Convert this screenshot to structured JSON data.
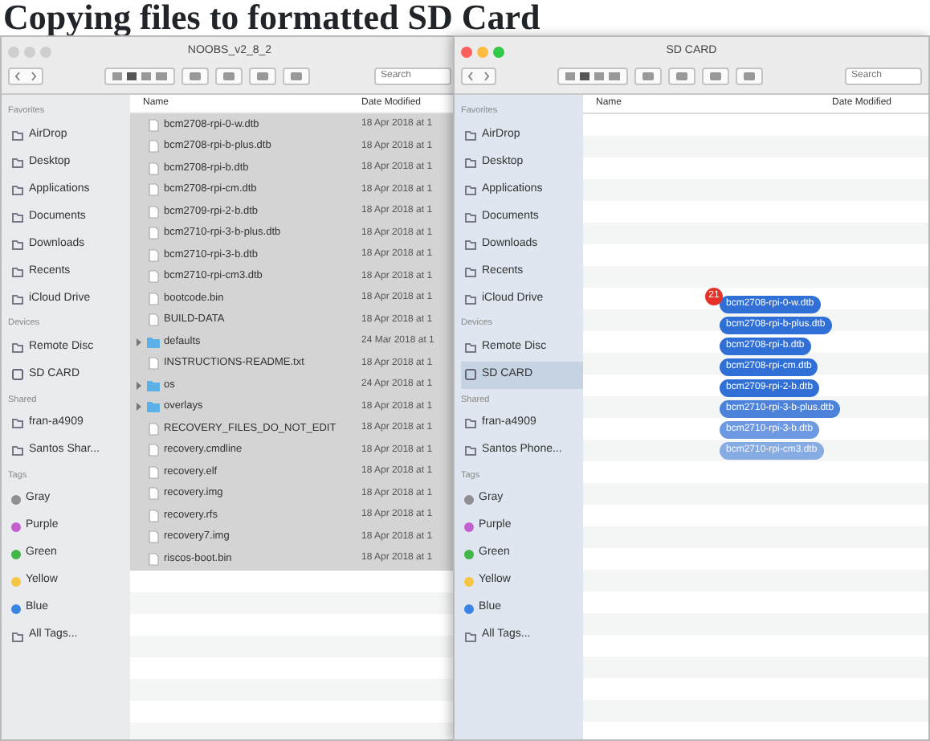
{
  "heading": "Copying files to formatted SD Card",
  "windows": [
    {
      "title": "NOOBS_v2_8_2",
      "active": false,
      "search": {
        "placeholder": "Search"
      },
      "sidebar": [
        {
          "section": "Favorites",
          "items": [
            {
              "label": "AirDrop",
              "kind": "place",
              "selected": false
            },
            {
              "label": "Desktop",
              "kind": "place",
              "selected": false
            },
            {
              "label": "Applications",
              "kind": "place",
              "selected": false
            },
            {
              "label": "Documents",
              "kind": "place",
              "selected": false
            },
            {
              "label": "Downloads",
              "kind": "place",
              "selected": false
            },
            {
              "label": "Recents",
              "kind": "place",
              "selected": false
            },
            {
              "label": "iCloud Drive",
              "kind": "place",
              "selected": false
            }
          ]
        },
        {
          "section": "Devices",
          "items": [
            {
              "label": "Remote Disc",
              "kind": "place",
              "selected": false
            },
            {
              "label": "SD CARD",
              "kind": "device",
              "selected": false
            }
          ]
        },
        {
          "section": "Shared",
          "items": [
            {
              "label": "fran-a4909",
              "kind": "place",
              "selected": false
            },
            {
              "label": "Santos Shar...",
              "kind": "place",
              "selected": false
            }
          ]
        },
        {
          "section": "Tags",
          "items": [
            {
              "label": "Gray",
              "kind": "tag",
              "color": "#8e8e93",
              "selected": false
            },
            {
              "label": "Purple",
              "kind": "tag",
              "color": "#c45fd0",
              "selected": false
            },
            {
              "label": "Green",
              "kind": "tag",
              "color": "#43b649",
              "selected": false
            },
            {
              "label": "Yellow",
              "kind": "tag",
              "color": "#f5c544",
              "selected": false
            },
            {
              "label": "Blue",
              "kind": "tag",
              "color": "#3a84e6",
              "selected": false
            },
            {
              "label": "All Tags...",
              "kind": "place",
              "selected": false
            }
          ]
        }
      ],
      "columns": [
        "Name",
        "Date Modified"
      ],
      "rows": [
        {
          "name": "bcm2708-rpi-0-w.dtb",
          "kind": "file",
          "date": "18 Apr 2018 at 1",
          "selected": true
        },
        {
          "name": "bcm2708-rpi-b-plus.dtb",
          "kind": "file",
          "date": "18 Apr 2018 at 1",
          "selected": true
        },
        {
          "name": "bcm2708-rpi-b.dtb",
          "kind": "file",
          "date": "18 Apr 2018 at 1",
          "selected": true
        },
        {
          "name": "bcm2708-rpi-cm.dtb",
          "kind": "file",
          "date": "18 Apr 2018 at 1",
          "selected": true
        },
        {
          "name": "bcm2709-rpi-2-b.dtb",
          "kind": "file",
          "date": "18 Apr 2018 at 1",
          "selected": true
        },
        {
          "name": "bcm2710-rpi-3-b-plus.dtb",
          "kind": "file",
          "date": "18 Apr 2018 at 1",
          "selected": true
        },
        {
          "name": "bcm2710-rpi-3-b.dtb",
          "kind": "file",
          "date": "18 Apr 2018 at 1",
          "selected": true
        },
        {
          "name": "bcm2710-rpi-cm3.dtb",
          "kind": "file",
          "date": "18 Apr 2018 at 1",
          "selected": true
        },
        {
          "name": "bootcode.bin",
          "kind": "file",
          "date": "18 Apr 2018 at 1",
          "selected": true
        },
        {
          "name": "BUILD-DATA",
          "kind": "file",
          "date": "18 Apr 2018 at 1",
          "selected": true
        },
        {
          "name": "defaults",
          "kind": "folder",
          "date": "24 Mar 2018 at 1",
          "selected": true
        },
        {
          "name": "INSTRUCTIONS-README.txt",
          "kind": "file",
          "date": "18 Apr 2018 at 1",
          "selected": true
        },
        {
          "name": "os",
          "kind": "folder",
          "date": "24 Apr 2018 at 1",
          "selected": true
        },
        {
          "name": "overlays",
          "kind": "folder",
          "date": "18 Apr 2018 at 1",
          "selected": true
        },
        {
          "name": "RECOVERY_FILES_DO_NOT_EDIT",
          "kind": "file",
          "date": "18 Apr 2018 at 1",
          "selected": true
        },
        {
          "name": "recovery.cmdline",
          "kind": "file",
          "date": "18 Apr 2018 at 1",
          "selected": true
        },
        {
          "name": "recovery.elf",
          "kind": "file",
          "date": "18 Apr 2018 at 1",
          "selected": true
        },
        {
          "name": "recovery.img",
          "kind": "file",
          "date": "18 Apr 2018 at 1",
          "selected": true
        },
        {
          "name": "recovery.rfs",
          "kind": "file",
          "date": "18 Apr 2018 at 1",
          "selected": true
        },
        {
          "name": "recovery7.img",
          "kind": "file",
          "date": "18 Apr 2018 at 1",
          "selected": true
        },
        {
          "name": "riscos-boot.bin",
          "kind": "file",
          "date": "18 Apr 2018 at 1",
          "selected": true
        }
      ]
    },
    {
      "title": "SD CARD",
      "active": true,
      "search": {
        "placeholder": "Search"
      },
      "sidebar": [
        {
          "section": "Favorites",
          "items": [
            {
              "label": "AirDrop",
              "kind": "place",
              "selected": false
            },
            {
              "label": "Desktop",
              "kind": "place",
              "selected": false
            },
            {
              "label": "Applications",
              "kind": "place",
              "selected": false
            },
            {
              "label": "Documents",
              "kind": "place",
              "selected": false
            },
            {
              "label": "Downloads",
              "kind": "place",
              "selected": false
            },
            {
              "label": "Recents",
              "kind": "place",
              "selected": false
            },
            {
              "label": "iCloud Drive",
              "kind": "place",
              "selected": false
            }
          ]
        },
        {
          "section": "Devices",
          "items": [
            {
              "label": "Remote Disc",
              "kind": "place",
              "selected": false
            },
            {
              "label": "SD CARD",
              "kind": "device",
              "selected": true
            }
          ]
        },
        {
          "section": "Shared",
          "items": [
            {
              "label": "fran-a4909",
              "kind": "place",
              "selected": false
            },
            {
              "label": "Santos Phone...",
              "kind": "place",
              "selected": false
            }
          ]
        },
        {
          "section": "Tags",
          "items": [
            {
              "label": "Gray",
              "kind": "tag",
              "color": "#8e8e93",
              "selected": false
            },
            {
              "label": "Purple",
              "kind": "tag",
              "color": "#c45fd0",
              "selected": false
            },
            {
              "label": "Green",
              "kind": "tag",
              "color": "#43b649",
              "selected": false
            },
            {
              "label": "Yellow",
              "kind": "tag",
              "color": "#f5c544",
              "selected": false
            },
            {
              "label": "Blue",
              "kind": "tag",
              "color": "#3a84e6",
              "selected": false
            },
            {
              "label": "All Tags...",
              "kind": "place",
              "selected": false
            }
          ]
        }
      ],
      "columns": [
        "Name",
        "Date Modified"
      ],
      "drag": {
        "count": "21",
        "items": [
          "bcm2708-rpi-0-w.dtb",
          "bcm2708-rpi-b-plus.dtb",
          "bcm2708-rpi-b.dtb",
          "bcm2708-rpi-cm.dtb",
          "bcm2709-rpi-2-b.dtb",
          "bcm2710-rpi-3-b-plus.dtb",
          "bcm2710-rpi-3-b.dtb",
          "bcm2710-rpi-cm3.dtb"
        ]
      }
    }
  ]
}
